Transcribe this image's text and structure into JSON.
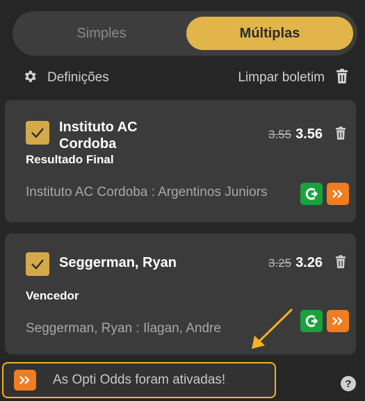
{
  "toggle": {
    "simples": "Simples",
    "multiplas": "Múltiplas",
    "active": "Múltiplas"
  },
  "settings": {
    "label": "Definições",
    "icon": "gear-icon"
  },
  "clear": {
    "label": "Limpar boletim",
    "icon": "trash-icon"
  },
  "bets": [
    {
      "selection": "Instituto AC Cordoba",
      "market": "Resultado Final",
      "old_odds": "3.55",
      "new_odds": "3.56",
      "event": "Instituto AC Cordoba : Argentinos Juniors",
      "checked": true
    },
    {
      "selection": "Seggerman, Ryan",
      "market": "Vencedor",
      "old_odds": "3.25",
      "new_odds": "3.26",
      "event": "Seggerman, Ryan : Ilagan, Andre",
      "checked": true
    }
  ],
  "opti": {
    "text": "As Opti Odds foram ativadas!",
    "badge_glyph": "»"
  },
  "help": {
    "glyph": "?"
  },
  "colors": {
    "accent": "#e1b54a",
    "background": "#262626",
    "card": "#3b3b3b",
    "green_badge": "#19a33c",
    "orange_badge": "#ef7d21",
    "highlight_border": "#f3b322"
  }
}
